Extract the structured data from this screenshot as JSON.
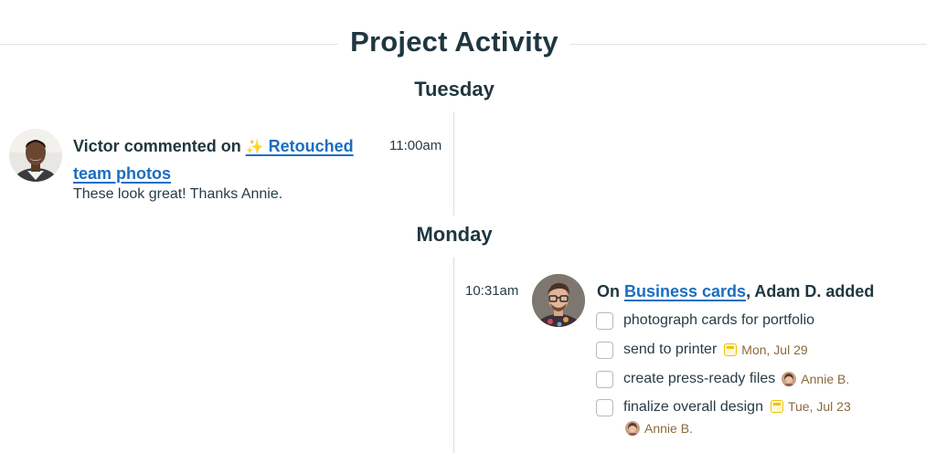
{
  "header": {
    "title": "Project Activity"
  },
  "days": [
    {
      "label": "Tuesday",
      "entries": [
        {
          "author": "Victor",
          "action_prefix": "Victor commented on ",
          "target_emoji": "✨",
          "target_link": "Retouched team photos",
          "time": "11:00am",
          "comment": "These look great! Thanks Annie."
        }
      ]
    },
    {
      "label": "Monday",
      "entries": [
        {
          "prefix": "On ",
          "target_link": "Business cards",
          "suffix": ", Adam D. added",
          "time": "10:31am",
          "todos": [
            {
              "text": "photograph cards for portfolio"
            },
            {
              "text": "send to printer",
              "due": "Mon, Jul 29"
            },
            {
              "text": "create press-ready files",
              "assignee": "Annie B."
            },
            {
              "text": "finalize overall design",
              "due": "Tue, Jul 23",
              "assignee": "Annie B."
            }
          ]
        }
      ]
    }
  ],
  "colors": {
    "heading": "#1f3640",
    "link": "#1a6ec2",
    "due_date_text": "#8a6a3c",
    "calendar_icon": "#f2c200",
    "sparkle": "#f2b705",
    "timeline": "#dcdcdc"
  },
  "icons": {
    "sparkle": "sparkles-icon",
    "calendar": "calendar-icon"
  }
}
